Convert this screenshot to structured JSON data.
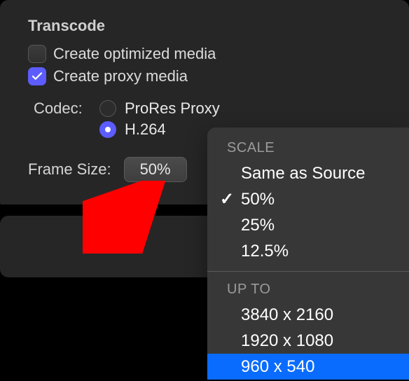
{
  "section": {
    "title": "Transcode"
  },
  "checks": {
    "optimized": {
      "label": "Create optimized media",
      "checked": false
    },
    "proxy": {
      "label": "Create proxy media",
      "checked": true
    }
  },
  "codec": {
    "label": "Codec:",
    "options": {
      "prores": "ProRes Proxy",
      "h264": "H.264"
    },
    "selected": "h264"
  },
  "frame": {
    "label": "Frame Size:",
    "value": "50%"
  },
  "menu": {
    "scale_header": "SCALE",
    "upto_header": "UP TO",
    "items_scale": [
      {
        "label": "Same as Source",
        "checked": false
      },
      {
        "label": "50%",
        "checked": true
      },
      {
        "label": "25%",
        "checked": false
      },
      {
        "label": "12.5%",
        "checked": false
      }
    ],
    "items_upto": [
      {
        "label": "3840 x 2160",
        "highlight": false
      },
      {
        "label": "1920 x 1080",
        "highlight": false
      },
      {
        "label": "960 x 540",
        "highlight": true
      }
    ]
  }
}
